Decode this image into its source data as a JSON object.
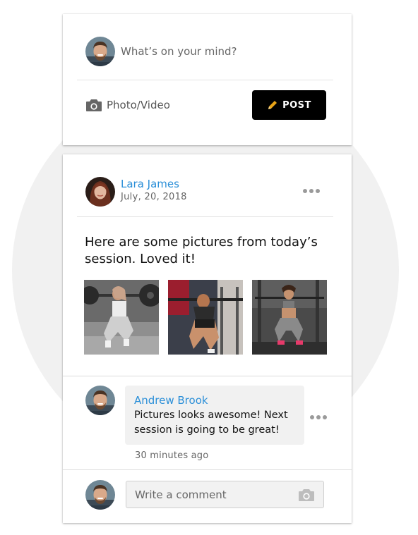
{
  "composer": {
    "placeholder": "What’s on your mind?",
    "photo_video_label": "Photo/Video",
    "post_label": "POST",
    "icons": {
      "camera": "camera-icon",
      "pencil": "pencil-icon"
    }
  },
  "post": {
    "author": "Lara James",
    "date": "July, 20, 2018",
    "text": "Here are some pictures from today’s session. Loved it!",
    "photos": [
      "workout-photo-1",
      "workout-photo-2",
      "workout-photo-3"
    ]
  },
  "comment": {
    "author": "Andrew Brook",
    "text": "Pictures looks awesome! Next session is going to be great!",
    "time": "30 minutes ago"
  },
  "reply": {
    "placeholder": "Write a comment"
  },
  "colors": {
    "link": "#2b8fd8",
    "post_button": "#000000",
    "pencil": "#e8a317",
    "background_circle": "#f1f1f1"
  }
}
